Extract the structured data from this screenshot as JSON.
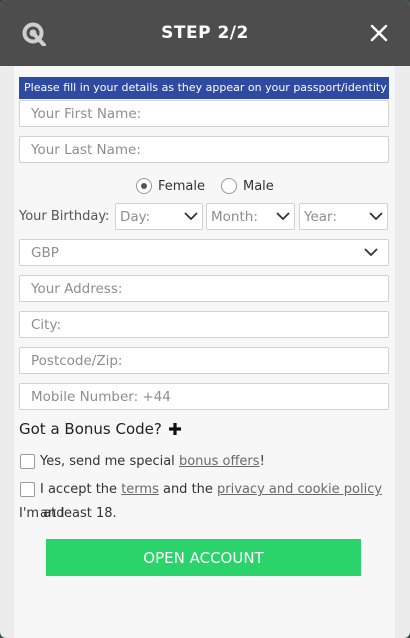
{
  "header": {
    "title": "STEP 2/2"
  },
  "notice": "Please fill in your details as they appear on your passport/identity",
  "fields": {
    "first_name": "Your First Name:",
    "last_name": "Your Last Name:",
    "address": "Your Address:",
    "city": "City:",
    "postcode": "Postcode/Zip:",
    "mobile": "Mobile Number: +44"
  },
  "gender": {
    "female": "Female",
    "male": "Male",
    "selected": "Female"
  },
  "birthday": {
    "label": "Your Birthday:",
    "day": "Day:",
    "month": "Month:",
    "year": "Year:"
  },
  "currency": "GBP",
  "bonus": {
    "label": "Got a Bonus Code?"
  },
  "consent": {
    "offers_prefix": "Yes, send me special ",
    "offers_link": "bonus offers",
    "offers_suffix": "!",
    "terms_prefix": "I accept the ",
    "terms_link": "terms",
    "terms_middle": " and the ",
    "privacy_link": "privacy and cookie policy",
    "terms_suffix": " and",
    "terms_line2": "I'm at least 18."
  },
  "submit_label": "OPEN ACCOUNT",
  "colors": {
    "header_bg": "#4d4d4d",
    "notice_bg": "#2e4aa3",
    "submit_bg": "#2bd46b"
  }
}
